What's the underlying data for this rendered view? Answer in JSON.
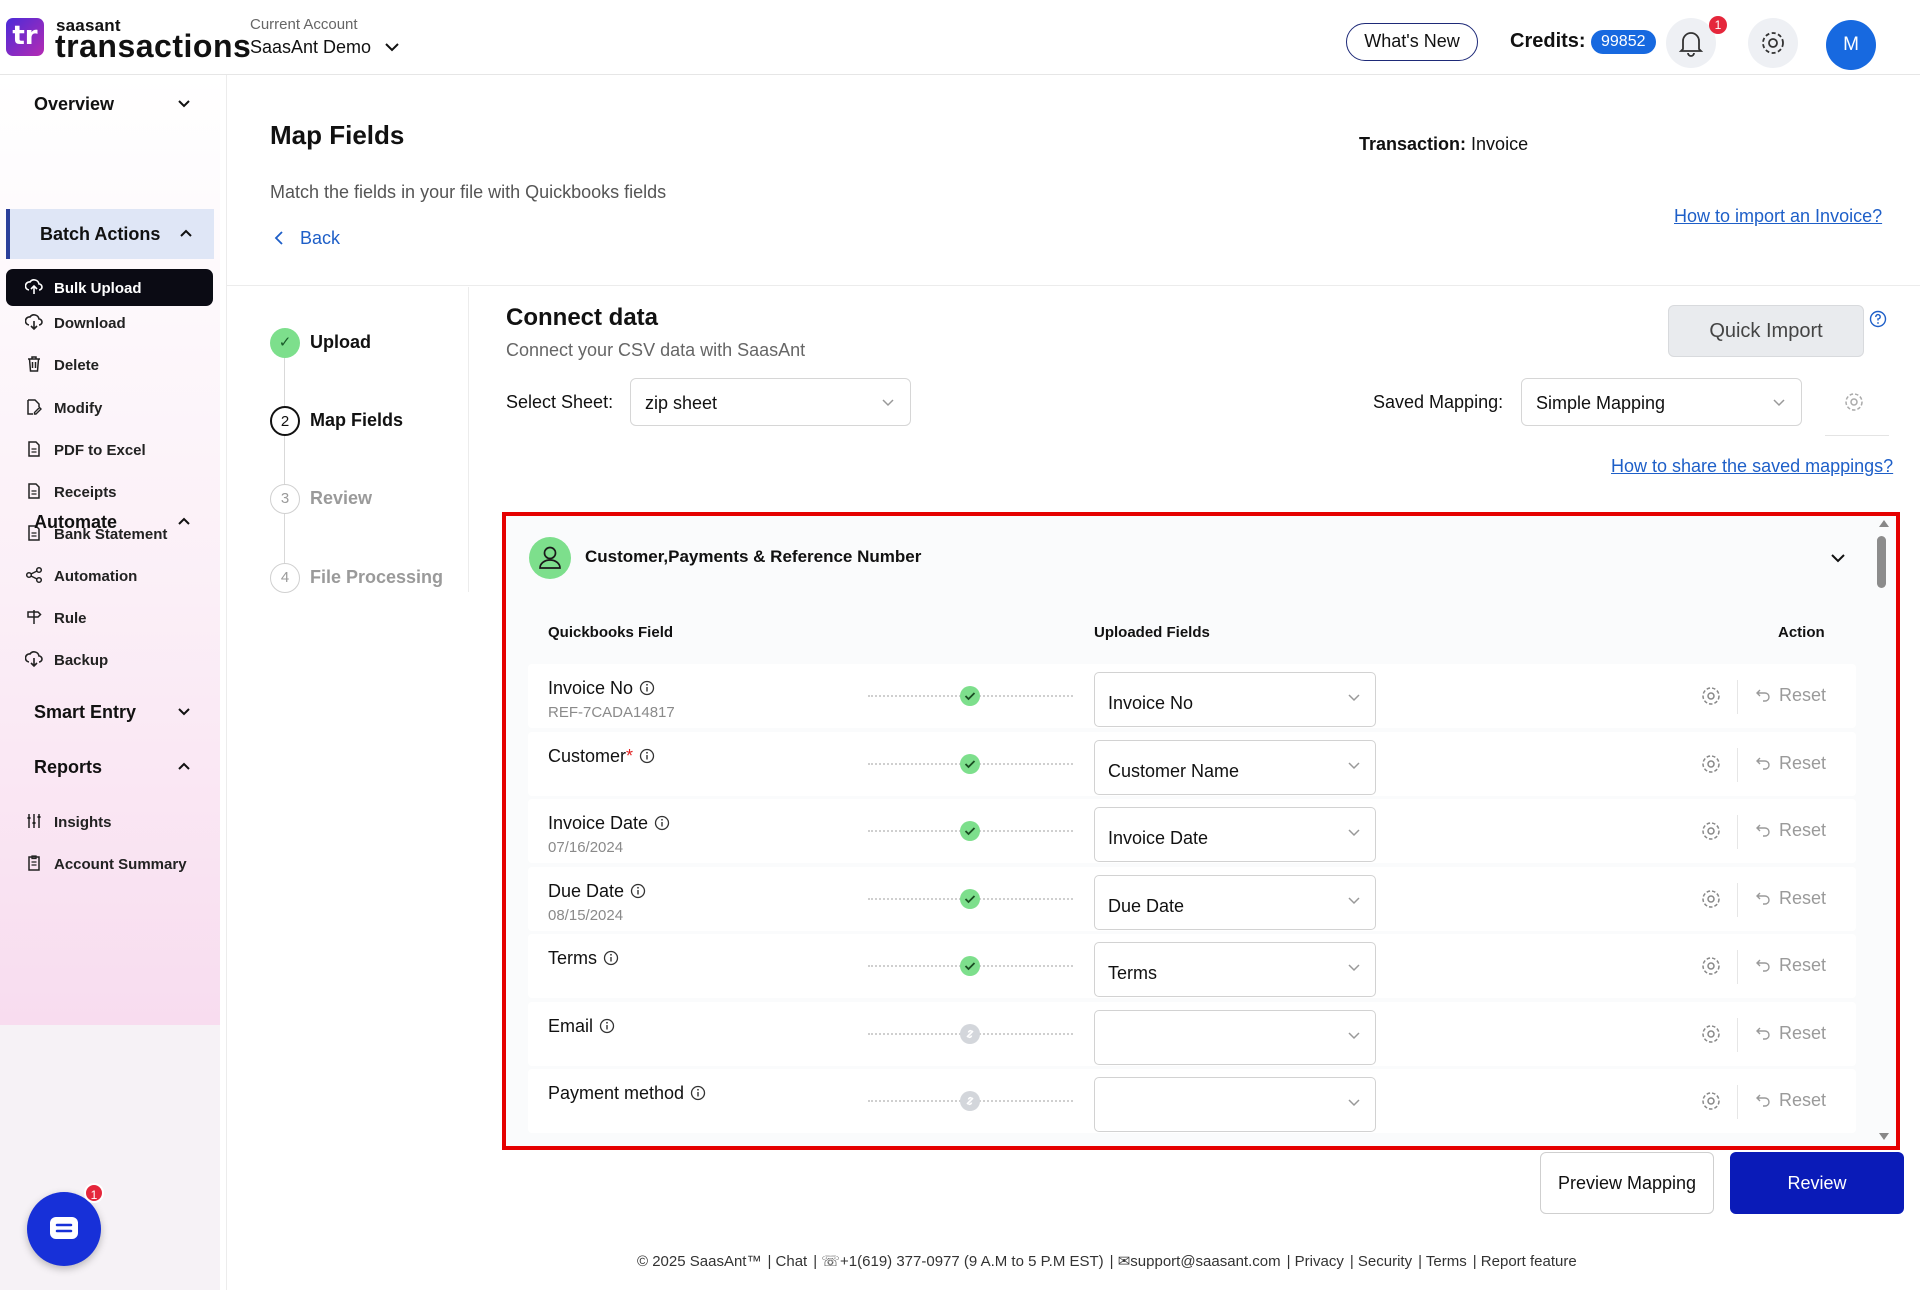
{
  "header": {
    "logo_text": "tr",
    "brand_small": "saasant",
    "brand_big": "transactions",
    "account_label": "Current Account",
    "account_name": "SaasAnt Demo",
    "whats_new": "What's New",
    "credits_label": "Credits:",
    "credits_value": "99852",
    "notification_count": "1",
    "avatar_initial": "M"
  },
  "sidebar": {
    "overview": "Overview",
    "batch_actions": "Batch Actions",
    "batch_items": {
      "bulk_upload": "Bulk Upload",
      "download": "Download",
      "delete": "Delete",
      "modify": "Modify",
      "pdf_to_excel": "PDF to Excel",
      "receipts": "Receipts",
      "bank_statement": "Bank Statement"
    },
    "automate": "Automate",
    "automate_items": {
      "automation": "Automation",
      "rule": "Rule",
      "backup": "Backup"
    },
    "smart_entry": "Smart Entry",
    "reports": "Reports",
    "report_items": {
      "insights": "Insights",
      "account_summary": "Account Summary"
    },
    "chat_badge": "1"
  },
  "page": {
    "title": "Map Fields",
    "subtitle": "Match the fields in your file with Quickbooks fields",
    "back": "Back",
    "transaction_label": "Transaction:",
    "transaction_value": "Invoice",
    "how_import": "How to import an Invoice?"
  },
  "steps": [
    {
      "num": "✓",
      "label": "Upload",
      "state": "done"
    },
    {
      "num": "2",
      "label": "Map Fields",
      "state": "active"
    },
    {
      "num": "3",
      "label": "Review",
      "state": "pending"
    },
    {
      "num": "4",
      "label": "File Processing",
      "state": "pending"
    }
  ],
  "connect": {
    "title": "Connect data",
    "subtitle": "Connect your CSV data with SaasAnt",
    "select_sheet_label": "Select Sheet:",
    "select_sheet_value": "zip sheet",
    "saved_mapping_label": "Saved Mapping:",
    "saved_mapping_value": "Simple Mapping",
    "quick_import": "Quick Import",
    "how_share": "How to share the saved mappings?"
  },
  "section": {
    "title": "Customer,Payments & Reference Number",
    "col_qb": "Quickbooks Field",
    "col_uploaded": "Uploaded Fields",
    "col_action": "Action",
    "reset_label": "Reset",
    "rows": [
      {
        "field": "Invoice No",
        "required": false,
        "sample": "REF-7CADA14817",
        "mapped": "Invoice No",
        "status": "mapped"
      },
      {
        "field": "Customer",
        "required": true,
        "sample": "",
        "mapped": "Customer Name",
        "status": "mapped"
      },
      {
        "field": "Invoice Date",
        "required": false,
        "sample": "07/16/2024",
        "mapped": "Invoice Date",
        "status": "mapped"
      },
      {
        "field": "Due Date",
        "required": false,
        "sample": "08/15/2024",
        "mapped": "Due Date",
        "status": "mapped"
      },
      {
        "field": "Terms",
        "required": false,
        "sample": "",
        "mapped": "Terms",
        "status": "mapped"
      },
      {
        "field": "Email",
        "required": false,
        "sample": "",
        "mapped": "",
        "status": "unmapped"
      },
      {
        "field": "Payment method",
        "required": false,
        "sample": "",
        "mapped": "",
        "status": "unmapped"
      }
    ]
  },
  "buttons": {
    "preview_mapping": "Preview Mapping",
    "review": "Review"
  },
  "footer": [
    "© 2025 SaasAnt™",
    "| Chat",
    "| ☏+1(619) 377-0977 (9 A.M to 5 P.M EST)",
    "| ✉support@saasant.com",
    "| Privacy",
    "| Security",
    "| Terms",
    "| Report feature"
  ],
  "colors": {
    "accent_blue": "#1769e0",
    "primary_button": "#0a1bb8",
    "highlight_border": "#e50000",
    "success_green": "#7ddf8c"
  }
}
